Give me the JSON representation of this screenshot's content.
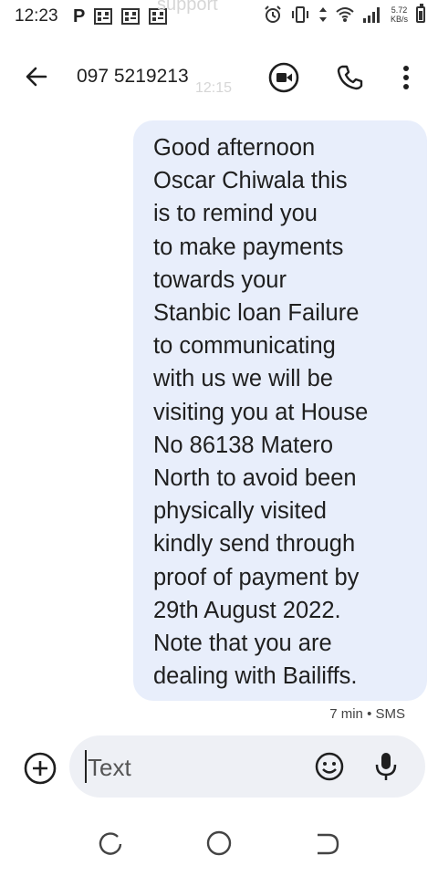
{
  "status_bar": {
    "time": "12:23",
    "left_icons": [
      "p-icon",
      "qr-icon",
      "qr-icon",
      "qr-icon"
    ],
    "net_speed_value": "5.72",
    "net_speed_unit": "KB/s",
    "right_icons": [
      "alarm-icon",
      "vibrate-icon",
      "data-arrows-icon",
      "wifi-icon",
      "signal-icon",
      "battery-icon"
    ]
  },
  "ghost_overlay": {
    "top_text": "support",
    "time_text": "12:15"
  },
  "app_bar": {
    "contact": "097 5219213",
    "icons": [
      "back-arrow-icon",
      "video-call-icon",
      "phone-icon",
      "more-vert-icon"
    ]
  },
  "message": {
    "text": "Good afternoon\nOscar Chiwala this\nis to remind you\nto make payments\ntowards your\nStanbic loan Failure\nto communicating\nwith us we will be\nvisiting you at House\nNo 86138 Matero\nNorth to avoid been\nphysically visited\nkindly send through\nproof of payment by\n29th August 2022.\nNote that you are\ndealing with Bailiffs.",
    "meta": "7 min • SMS"
  },
  "compose": {
    "placeholder": "Text",
    "icons": [
      "add-circle-icon",
      "emoji-icon",
      "mic-icon"
    ]
  },
  "nav_bar": {
    "icons": [
      "recents-icon",
      "home-icon",
      "back-icon"
    ]
  },
  "colors": {
    "bubble": "#e8eefb",
    "compose_bg": "#eef0f5",
    "text": "#1f1f1f"
  }
}
